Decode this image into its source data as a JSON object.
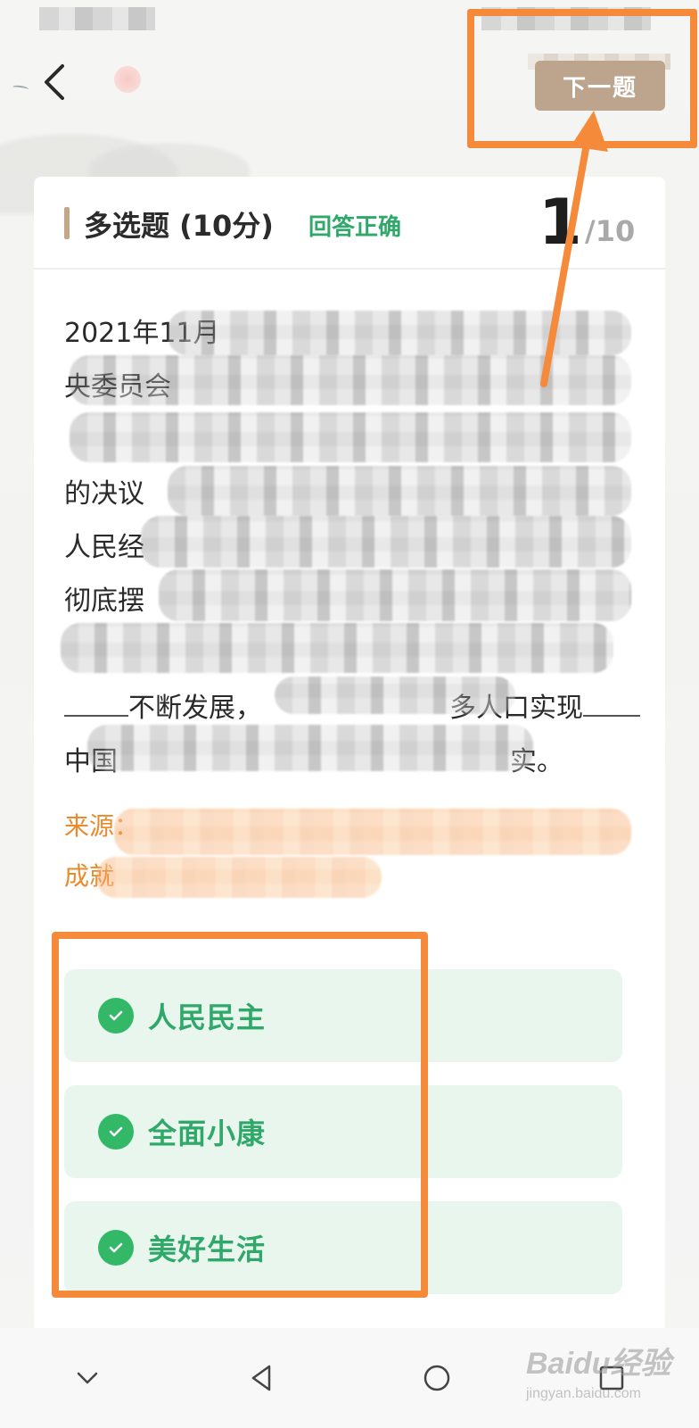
{
  "header": {
    "back_icon": "chevron-left-icon",
    "next_label": "下一题"
  },
  "question_card": {
    "type_label": "多选题 (10分)",
    "status_label": "回答正确",
    "current_number": "1",
    "total_label": "/10",
    "text_lines": [
      "2021年11月",
      "央委员会",
      "",
      "的决议",
      "人民经",
      "彻底摆",
      "",
      "不断发展，",
      "中国"
    ],
    "visible_fragments": {
      "line4_end": "实。",
      "line8_tail": "多人口实现"
    },
    "source_label": "来源：",
    "source_line2": "成就"
  },
  "options": [
    {
      "label": "人民民主",
      "icon": "check-circle-icon",
      "correct": true
    },
    {
      "label": "全面小康",
      "icon": "check-circle-icon",
      "correct": true
    },
    {
      "label": "美好生活",
      "icon": "check-circle-icon",
      "correct": true
    }
  ],
  "navbar": {
    "items": [
      "chevron-down-icon",
      "back-triangle-icon",
      "home-circle-icon",
      "recents-square-icon"
    ]
  },
  "watermark": {
    "main": "Baidu经验",
    "sub": "jingyan.baidu.com"
  },
  "colors": {
    "accent": "#c3a788",
    "next_button": "#bda58d",
    "correct_green": "#2fa86a",
    "highlight_orange": "#f58a3a",
    "source_orange": "#e98a2c"
  }
}
